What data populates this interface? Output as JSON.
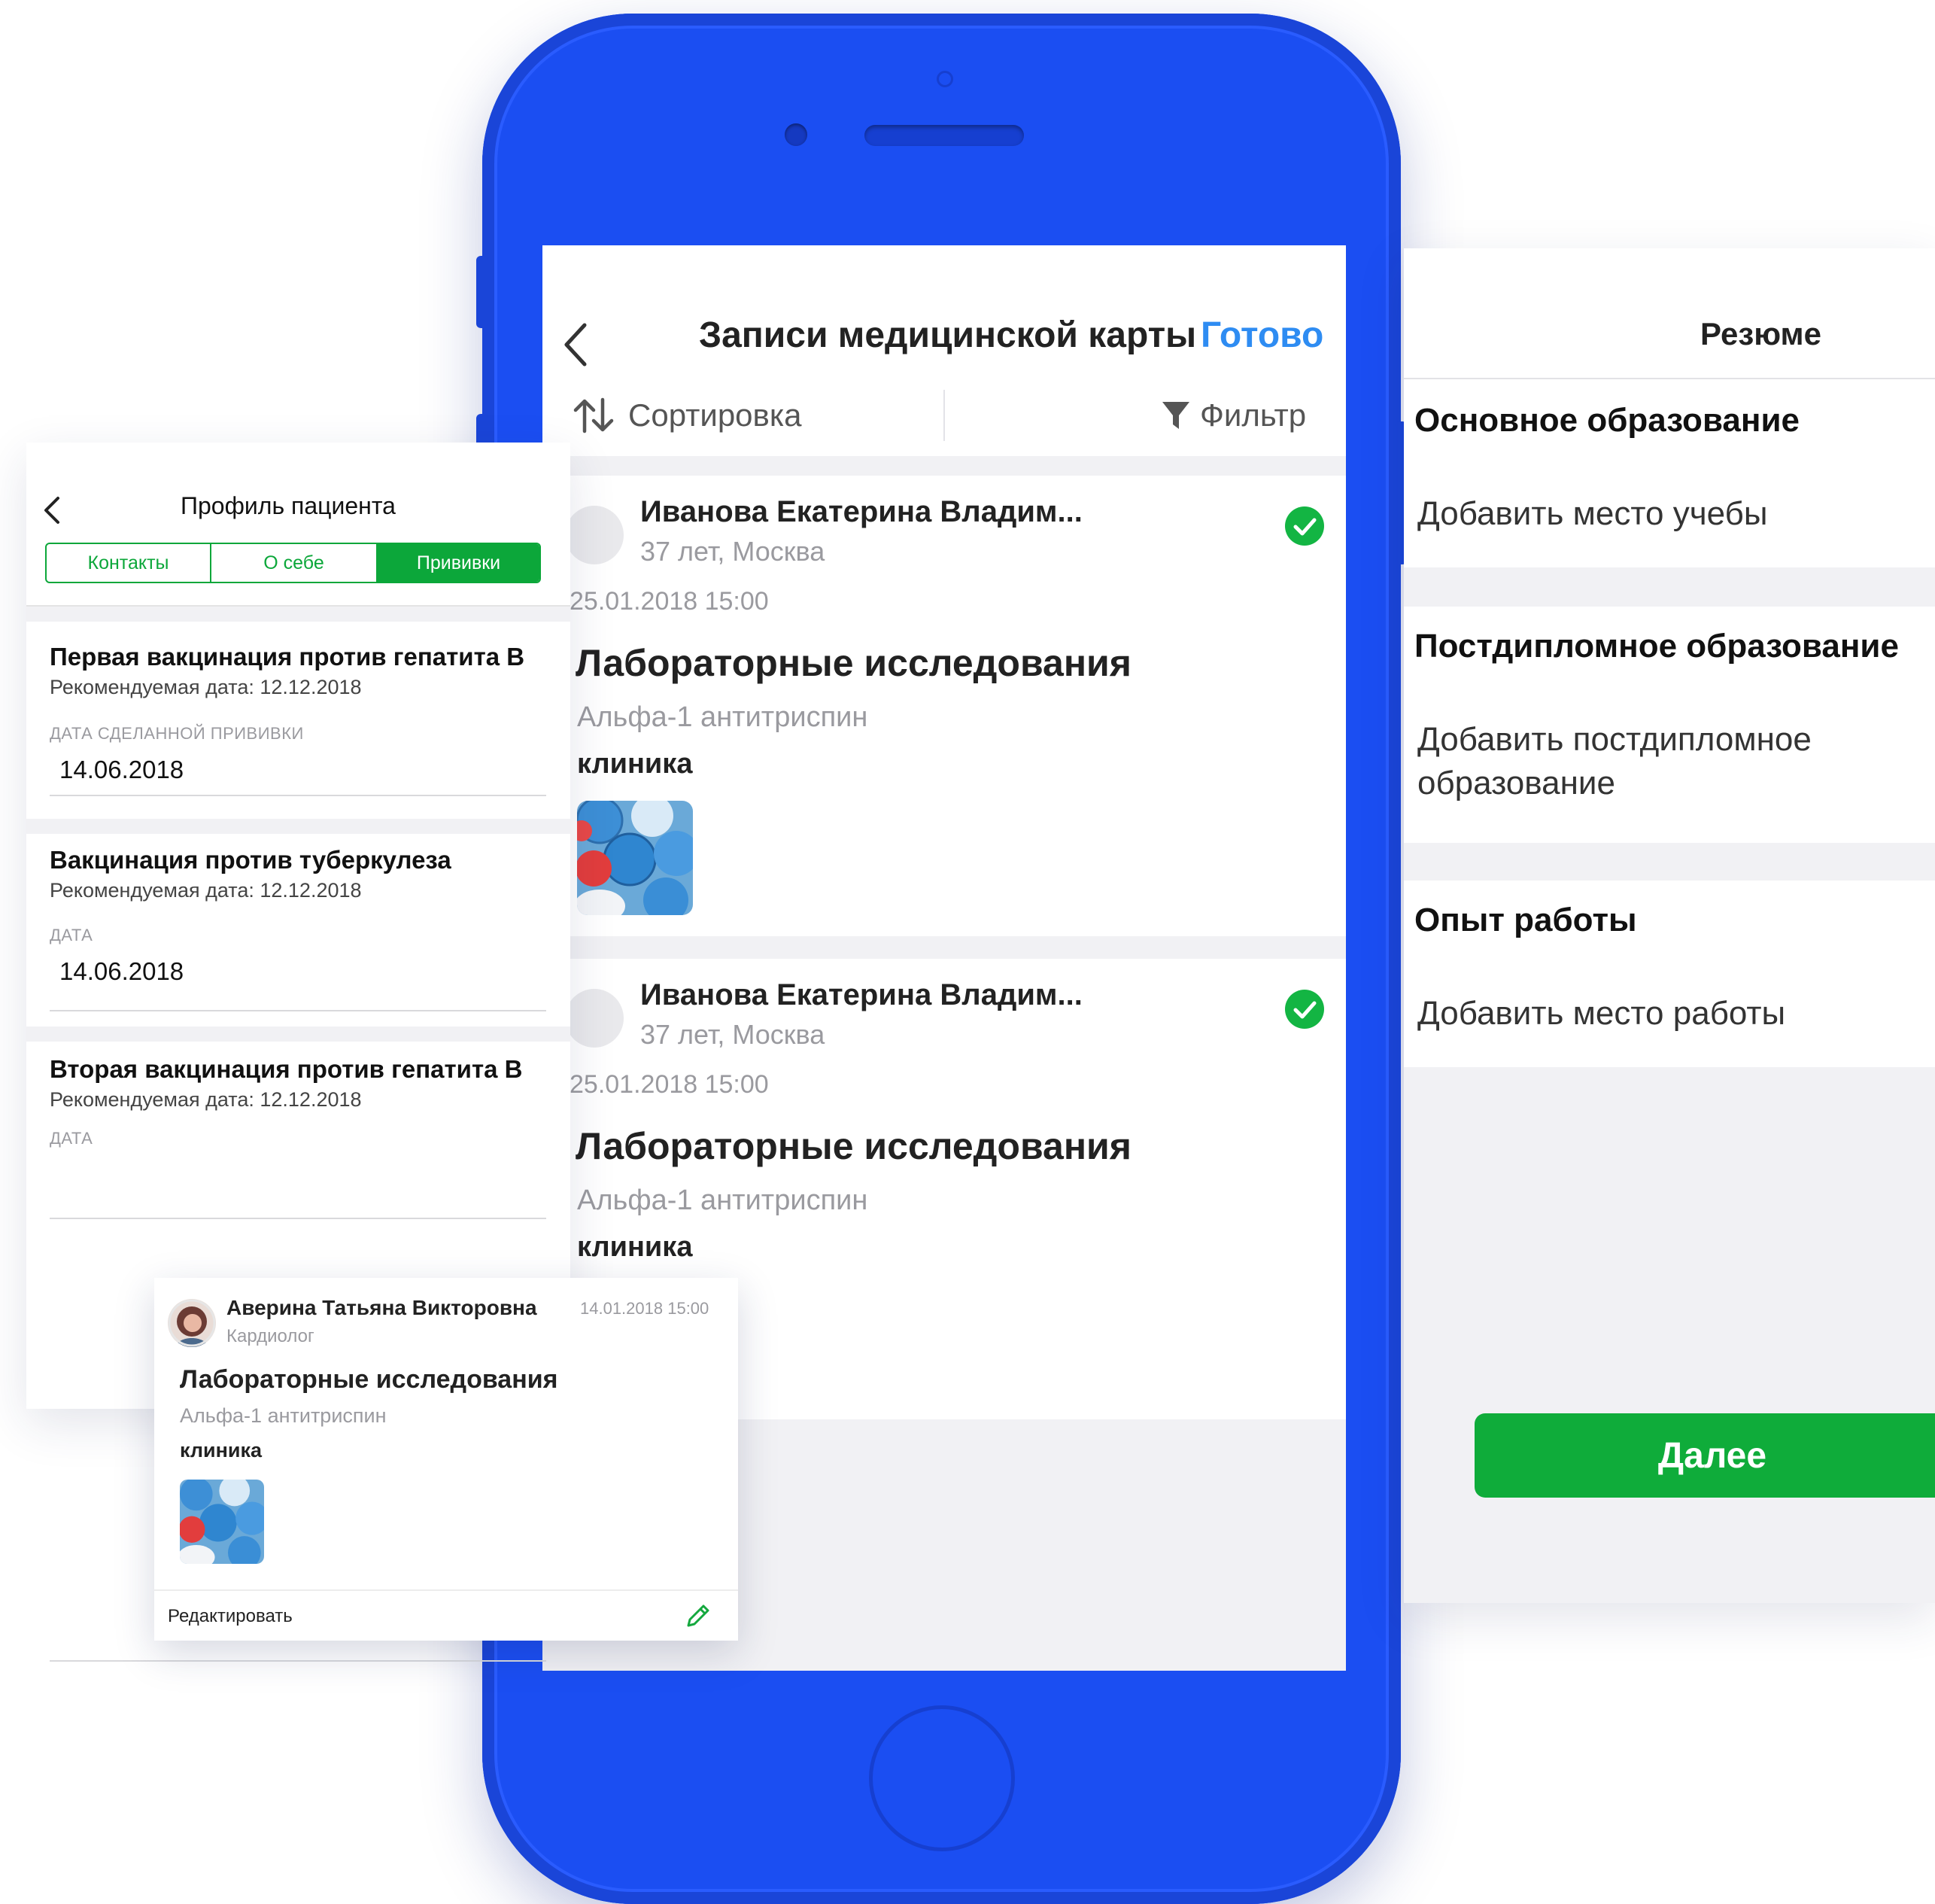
{
  "colors": {
    "phone_body": "#1b4ef2",
    "accent_green": "#0ca73a",
    "link_blue": "#2e8cf2",
    "screen_background": "#f1f1f4"
  },
  "main_screen": {
    "back_icon": "chevron-left-icon",
    "title": "Записи медицинской карты",
    "done_label": "Готово",
    "sort_icon": "sort-arrows-icon",
    "sort_label": "Сортировка",
    "filter_icon": "filter-funnel-icon",
    "filter_label": "Фильтр",
    "records": [
      {
        "patient_name": "Иванова Екатерина Владим...",
        "patient_meta": "37 лет, Москва",
        "datetime": "25.01.2018 15:00",
        "record_title": "Лабораторные исследования",
        "record_subtitle": "Альфа-1 антитриспин",
        "clinic": "клиника",
        "status_icon": "check-circle-icon",
        "has_thumbnail": true
      },
      {
        "patient_name": "Иванова Екатерина Владим...",
        "patient_meta": "37 лет, Москва",
        "datetime": "25.01.2018 15:00",
        "record_title": "Лабораторные исследования",
        "record_subtitle": "Альфа-1 антитриспин",
        "clinic": "клиника",
        "status_icon": "check-circle-icon",
        "has_thumbnail": false
      }
    ]
  },
  "profile_panel": {
    "back_icon": "chevron-left-icon",
    "title": "Профиль пациента",
    "tabs": [
      {
        "label": "Контакты",
        "active": false
      },
      {
        "label": "О себе",
        "active": false
      },
      {
        "label": "Прививки",
        "active": true
      }
    ],
    "vaccinations": [
      {
        "title": "Первая вакцинация против гепатита B",
        "recommended": "Рекомендуемая дата: 12.12.2018",
        "date_label": "ДАТА СДЕЛАННОЙ ПРИВИВКИ",
        "date_value": "14.06.2018"
      },
      {
        "title": "Вакцинация против туберкулеза",
        "recommended": "Рекомендуемая дата: 12.12.2018",
        "date_label": "ДАТА",
        "date_value": "14.06.2018"
      },
      {
        "title": "Вторая вакцинация против гепатита B",
        "recommended": "Рекомендуемая дата: 12.12.2018",
        "date_label": "ДАТА",
        "date_value": ""
      }
    ]
  },
  "doctor_card": {
    "doctor_name": "Аверина Татьяна Викторовна",
    "doctor_role": "Кардиолог",
    "datetime": "14.01.2018 15:00",
    "record_title": "Лабораторные исследования",
    "record_subtitle": "Альфа-1 антитриспин",
    "clinic": "клиника",
    "edit_label": "Редактировать",
    "edit_icon": "pencil-icon"
  },
  "resume_panel": {
    "title": "Резюме",
    "sections": [
      {
        "heading": "Основное образование",
        "action": "Добавить место учебы"
      },
      {
        "heading": "Постдипломное образование",
        "action_line1": "Добавить постдипломное",
        "action_line2": "образование"
      },
      {
        "heading": "Опыт работы",
        "action": "Добавить место работы"
      }
    ],
    "next_label": "Далее"
  }
}
